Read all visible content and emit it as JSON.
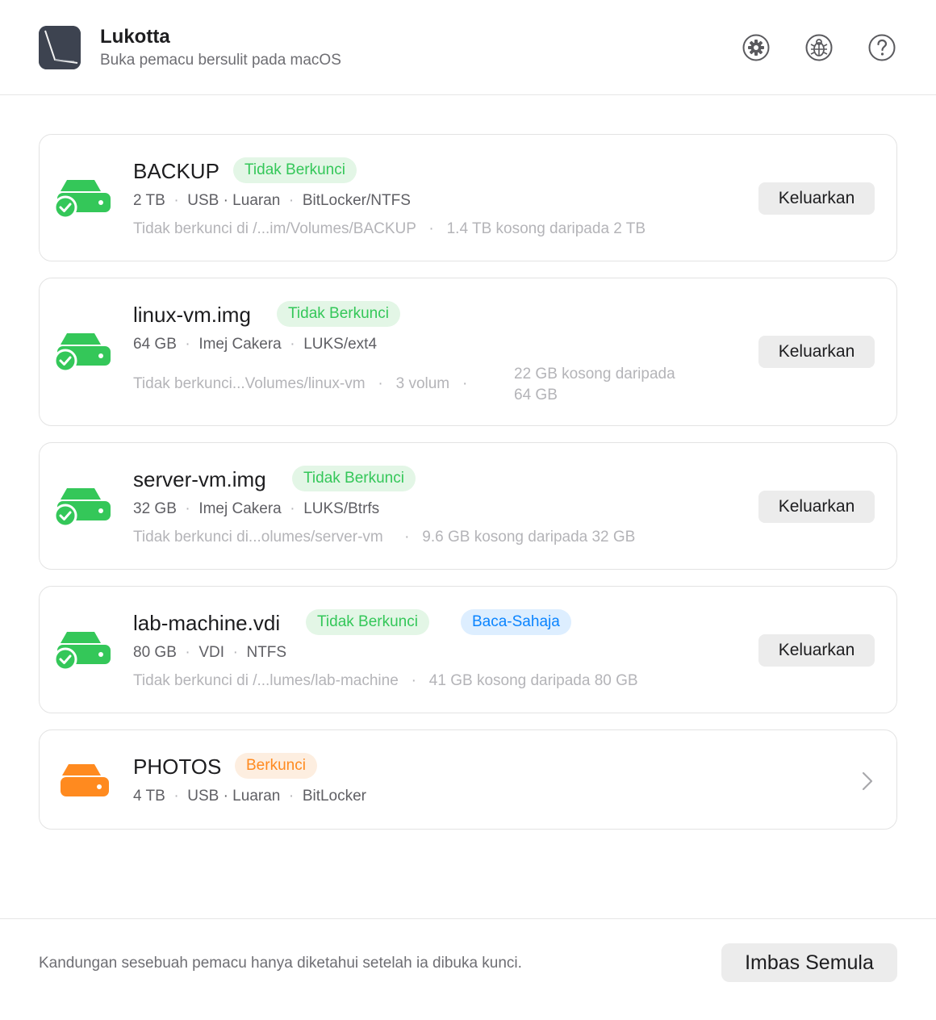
{
  "app": {
    "title": "Lukotta",
    "subtitle": "Buka pemacu bersulit pada macOS",
    "icons": [
      "gear-icon",
      "bug-icon",
      "help-icon"
    ]
  },
  "colors": {
    "unlocked_green": "#34c759",
    "locked_orange": "#ff8a1f",
    "readonly_blue": "#0a84ff"
  },
  "drives": [
    {
      "name": "BACKUP",
      "status": "Tidak Berkunci",
      "size": "2 TB",
      "connection": "USB · Luaran",
      "format": "BitLocker/NTFS",
      "mount": "Tidak berkunci di /...im/Volumes/BACKUP",
      "free": "1.4 TB kosong daripada 2 TB",
      "action": "Keluarkan"
    },
    {
      "name": "linux-vm.img",
      "status": "Tidak Berkunci",
      "size": "64 GB",
      "connection": "Imej Cakera",
      "format": "LUKS/ext4",
      "mount": "Tidak berkunci...Volumes/linux-vm",
      "volumes": "3 volum",
      "free_line1": "22 GB kosong daripada",
      "free_line2": "64 GB",
      "action": "Keluarkan"
    },
    {
      "name": "server-vm.img",
      "status": "Tidak Berkunci",
      "size": "32 GB",
      "connection": "Imej Cakera",
      "format": "LUKS/Btrfs",
      "mount": "Tidak berkunci di...olumes/server-vm",
      "free": "9.6 GB kosong daripada 32 GB",
      "action": "Keluarkan"
    },
    {
      "name": "lab-machine.vdi",
      "status": "Tidak Berkunci",
      "extra_badge": "Baca-Sahaja",
      "size": "80 GB",
      "connection": "VDI",
      "format": "NTFS",
      "mount": "Tidak berkunci di /...lumes/lab-machine",
      "free": "41 GB kosong daripada 80 GB",
      "action": "Keluarkan"
    },
    {
      "name": "PHOTOS",
      "status": "Berkunci",
      "size": "4 TB",
      "connection": "USB · Luaran",
      "format": "BitLocker"
    }
  ],
  "footer": {
    "note": "Kandungan sesebuah pemacu hanya diketahui setelah ia dibuka kunci.",
    "rescan_label": "Imbas Semula"
  }
}
